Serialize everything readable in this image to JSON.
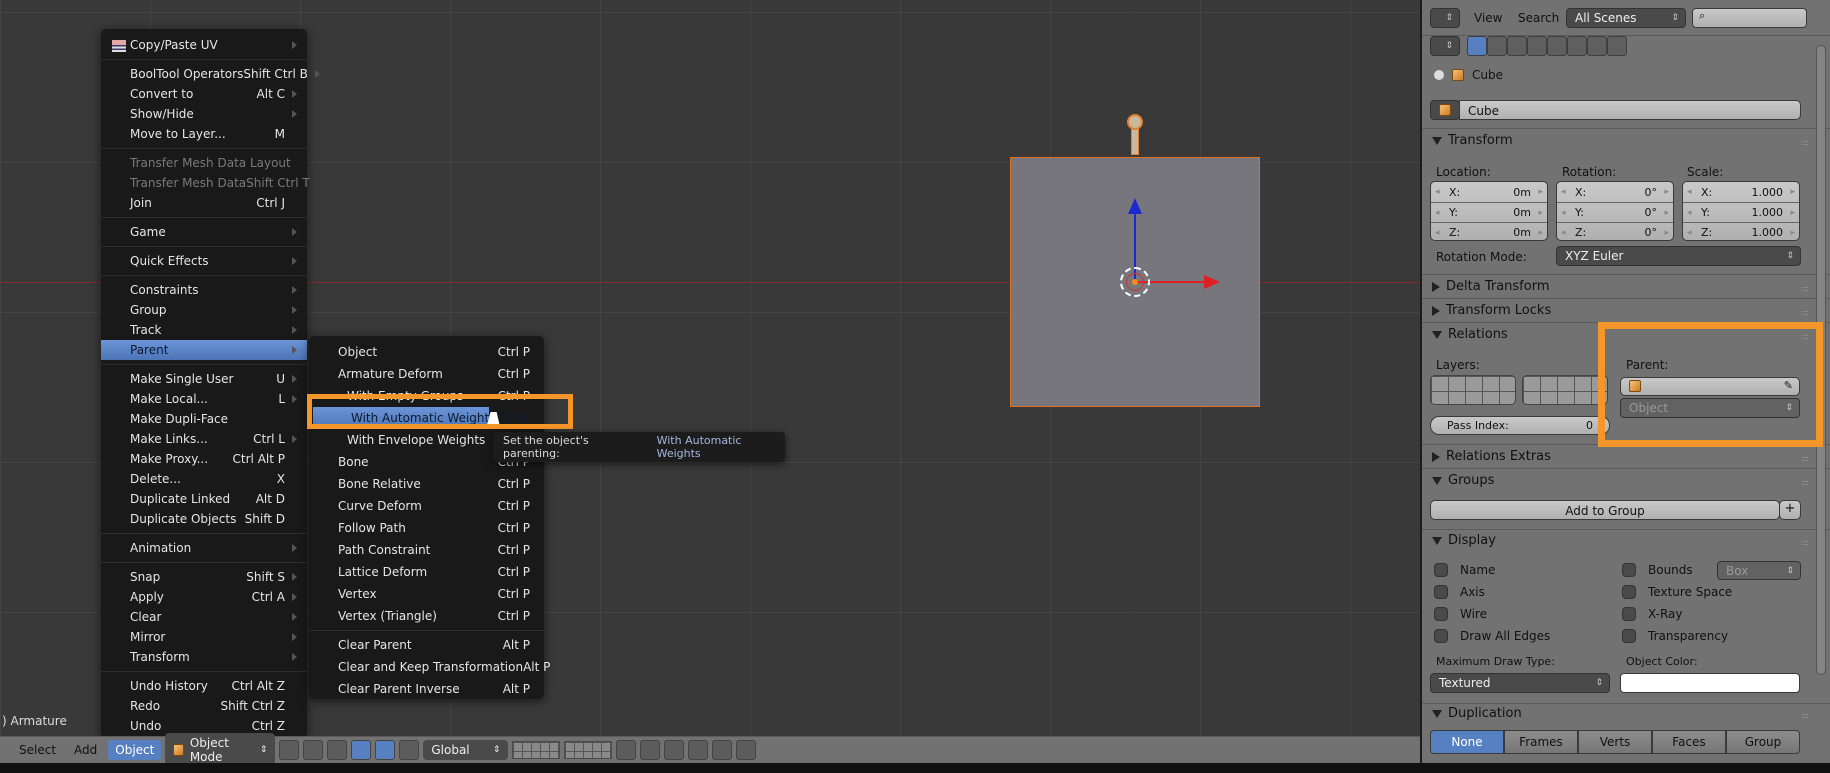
{
  "viewport": {
    "object_label": ") Armature"
  },
  "object_menu": {
    "items": [
      {
        "label": "Copy/Paste UV",
        "shortcut": "",
        "submenu": true,
        "icon": "uv-icon"
      },
      {
        "label": "BoolTool Operators",
        "shortcut": "Shift Ctrl B",
        "submenu": true
      },
      {
        "label": "Convert to",
        "shortcut": "Alt C",
        "submenu": true
      },
      {
        "label": "Show/Hide",
        "shortcut": "",
        "submenu": true
      },
      {
        "label": "Move to Layer...",
        "shortcut": "M",
        "submenu": false
      },
      {
        "label": "Transfer Mesh Data Layout",
        "shortcut": "",
        "submenu": false,
        "disabled": true
      },
      {
        "label": "Transfer Mesh Data",
        "shortcut": "Shift Ctrl T",
        "submenu": false,
        "disabled": true
      },
      {
        "label": "Join",
        "shortcut": "Ctrl J",
        "submenu": false
      },
      {
        "label": "Game",
        "shortcut": "",
        "submenu": true
      },
      {
        "label": "Quick Effects",
        "shortcut": "",
        "submenu": true
      },
      {
        "label": "Constraints",
        "shortcut": "",
        "submenu": true
      },
      {
        "label": "Group",
        "shortcut": "",
        "submenu": true
      },
      {
        "label": "Track",
        "shortcut": "",
        "submenu": true
      },
      {
        "label": "Parent",
        "shortcut": "",
        "submenu": true,
        "active": true
      },
      {
        "label": "Make Single User",
        "shortcut": "U",
        "submenu": true
      },
      {
        "label": "Make Local...",
        "shortcut": "L",
        "submenu": true
      },
      {
        "label": "Make Dupli-Face",
        "shortcut": "",
        "submenu": false
      },
      {
        "label": "Make Links...",
        "shortcut": "Ctrl L",
        "submenu": true
      },
      {
        "label": "Make Proxy...",
        "shortcut": "Ctrl Alt P",
        "submenu": false
      },
      {
        "label": "Delete...",
        "shortcut": "X",
        "submenu": false
      },
      {
        "label": "Duplicate Linked",
        "shortcut": "Alt D",
        "submenu": false
      },
      {
        "label": "Duplicate Objects",
        "shortcut": "Shift D",
        "submenu": false
      },
      {
        "label": "Animation",
        "shortcut": "",
        "submenu": true
      },
      {
        "label": "Snap",
        "shortcut": "Shift S",
        "submenu": true
      },
      {
        "label": "Apply",
        "shortcut": "Ctrl A",
        "submenu": true
      },
      {
        "label": "Clear",
        "shortcut": "",
        "submenu": true
      },
      {
        "label": "Mirror",
        "shortcut": "",
        "submenu": true
      },
      {
        "label": "Transform",
        "shortcut": "",
        "submenu": true
      },
      {
        "label": "Undo History",
        "shortcut": "Ctrl Alt Z",
        "submenu": false
      },
      {
        "label": "Redo",
        "shortcut": "Shift Ctrl Z",
        "submenu": false
      },
      {
        "label": "Undo",
        "shortcut": "Ctrl Z",
        "submenu": false
      }
    ]
  },
  "parent_menu": {
    "items": [
      {
        "label": "Object",
        "shortcut": "Ctrl P"
      },
      {
        "label": "Armature Deform",
        "shortcut": "Ctrl P"
      },
      {
        "label": "With Empty Groups",
        "shortcut": "Ctrl P",
        "indent": true
      },
      {
        "label": "With Automatic Weights",
        "shortcut": "Ctrl P",
        "indent": true,
        "active": true
      },
      {
        "label": "With Envelope Weights",
        "shortcut": "Ctrl P",
        "indent": true
      },
      {
        "label": "Bone",
        "shortcut": "Ctrl P"
      },
      {
        "label": "Bone Relative",
        "shortcut": "Ctrl P"
      },
      {
        "label": "Curve Deform",
        "shortcut": "Ctrl P"
      },
      {
        "label": "Follow Path",
        "shortcut": "Ctrl P"
      },
      {
        "label": "Path Constraint",
        "shortcut": "Ctrl P"
      },
      {
        "label": "Lattice Deform",
        "shortcut": "Ctrl P"
      },
      {
        "label": "Vertex",
        "shortcut": "Ctrl P"
      },
      {
        "label": "Vertex (Triangle)",
        "shortcut": "Ctrl P"
      },
      {
        "label": "Clear Parent",
        "shortcut": "Alt P"
      },
      {
        "label": "Clear and Keep Transformation",
        "shortcut": "Alt P"
      },
      {
        "label": "Clear Parent Inverse",
        "shortcut": "Alt P"
      }
    ]
  },
  "tooltip": {
    "text": "Set the object's parenting:",
    "value": "With Automatic Weights"
  },
  "bottom_header": {
    "select": "Select",
    "add": "Add",
    "object": "Object",
    "mode": "Object Mode",
    "orientation": "Global"
  },
  "outliner_header": {
    "view": "View",
    "search": "Search",
    "scenes": "All Scenes",
    "search_placeholder": ""
  },
  "properties": {
    "breadcrumb": "Cube",
    "object_name": "Cube",
    "transform": {
      "title": "Transform",
      "location_label": "Location:",
      "rotation_label": "Rotation:",
      "scale_label": "Scale:",
      "location": [
        {
          "k": "X:",
          "v": "0m"
        },
        {
          "k": "Y:",
          "v": "0m"
        },
        {
          "k": "Z:",
          "v": "0m"
        }
      ],
      "rotation": [
        {
          "k": "X:",
          "v": "0°"
        },
        {
          "k": "Y:",
          "v": "0°"
        },
        {
          "k": "Z:",
          "v": "0°"
        }
      ],
      "scale": [
        {
          "k": "X:",
          "v": "1.000"
        },
        {
          "k": "Y:",
          "v": "1.000"
        },
        {
          "k": "Z:",
          "v": "1.000"
        }
      ],
      "rotation_mode_label": "Rotation Mode:",
      "rotation_mode": "XYZ Euler"
    },
    "delta_transform": "Delta Transform",
    "transform_locks": "Transform Locks",
    "relations": {
      "title": "Relations",
      "layers_label": "Layers:",
      "parent_label": "Parent:",
      "parent_value": "",
      "parent_type": "Object",
      "pass_index_label": "Pass Index:",
      "pass_index": "0"
    },
    "relations_extras": "Relations Extras",
    "groups": {
      "title": "Groups",
      "add_button": "Add to Group"
    },
    "display": {
      "title": "Display",
      "left": [
        "Name",
        "Axis",
        "Wire",
        "Draw All Edges"
      ],
      "right": [
        "Bounds",
        "Texture Space",
        "X-Ray",
        "Transparency"
      ],
      "bounds_type": "Box",
      "max_draw_label": "Maximum Draw Type:",
      "max_draw": "Textured",
      "color_label": "Object Color:"
    },
    "duplication": {
      "title": "Duplication",
      "options": [
        "None",
        "Frames",
        "Verts",
        "Faces",
        "Group"
      ],
      "selected": "None"
    }
  },
  "colors": {
    "accent": "#5680c2",
    "highlight": "#f5962a",
    "selection_outline": "#e07020"
  }
}
